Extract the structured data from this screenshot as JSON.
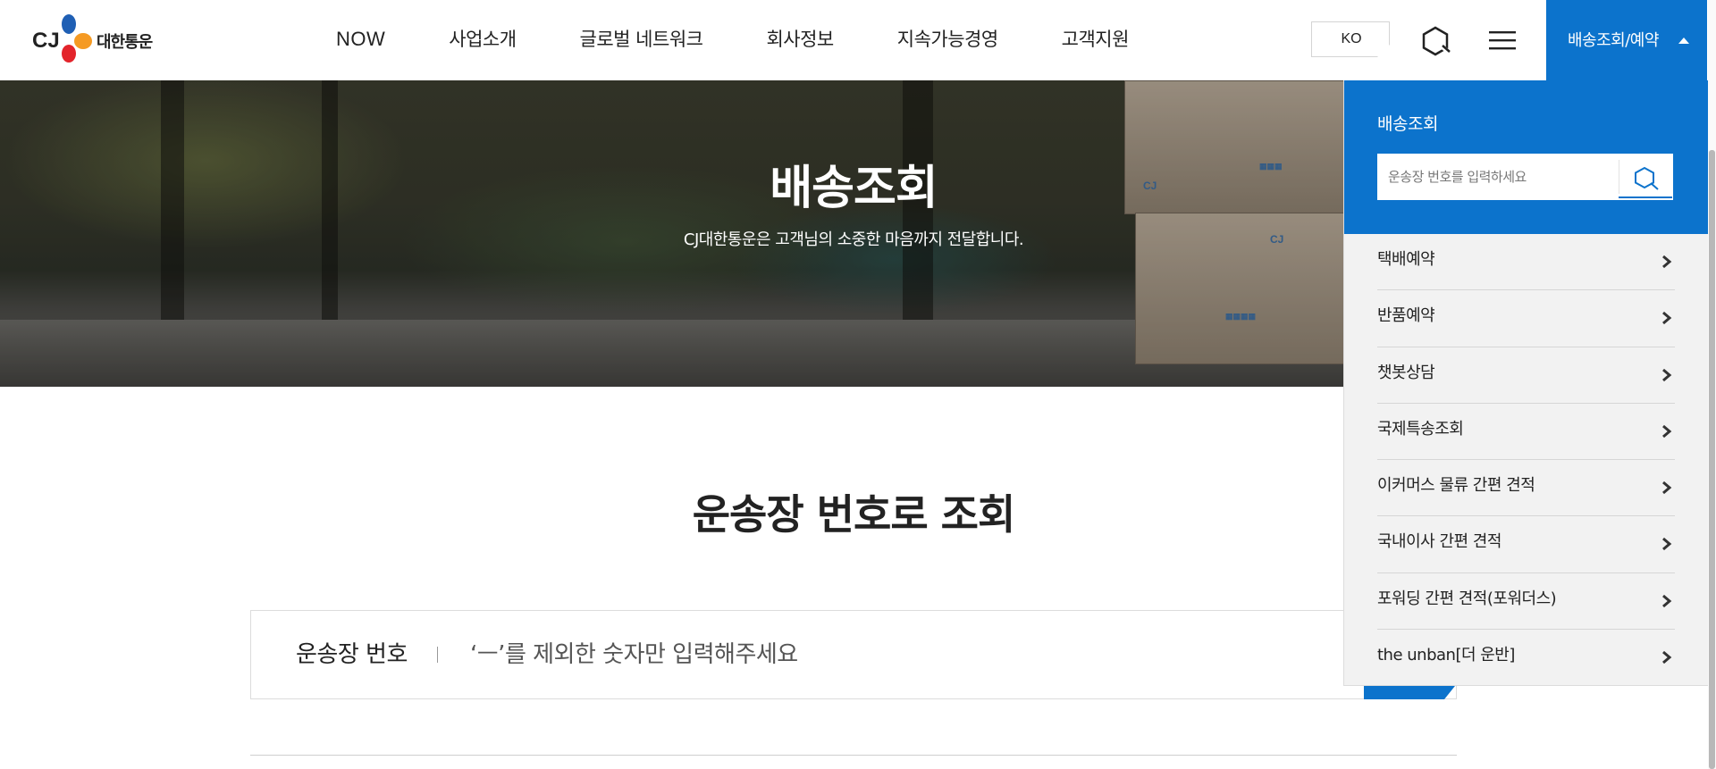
{
  "header": {
    "logo_text": "대한통운",
    "logo_letters": "CJ",
    "nav": [
      "NOW",
      "사업소개",
      "글로벌 네트워크",
      "회사정보",
      "지속가능경영",
      "고객지원"
    ],
    "lang_label": "KO",
    "booking_label": "배송조회/예약"
  },
  "hero": {
    "title": "배송조회",
    "subtitle": "CJ대한통운은 고객님의 소중한 마음까지 전달합니다."
  },
  "main": {
    "title": "운송장 번호로 조회",
    "field_label": "운송장 번호",
    "placeholder": "‘ㅡ’를 제외한 숫자만 입력해주세요"
  },
  "panel": {
    "title": "배송조회",
    "search_placeholder": "운송장 번호를 입력하세요",
    "items": [
      "택배예약",
      "반품예약",
      "챗봇상담",
      "국제특송조회",
      "이커머스 물류 간편 견적",
      "국내이사 간편 견적",
      "포워딩 간편 견적(포워더스)",
      "the unban[더 운반]"
    ]
  },
  "colors": {
    "brand_blue": "#0c73cc",
    "logo_red": "#e3242b",
    "logo_orange": "#f59a23",
    "logo_blue": "#1f5fb4"
  },
  "icons": [
    "search-icon",
    "menu-icon",
    "caret-up-icon",
    "chevron-right-icon"
  ]
}
